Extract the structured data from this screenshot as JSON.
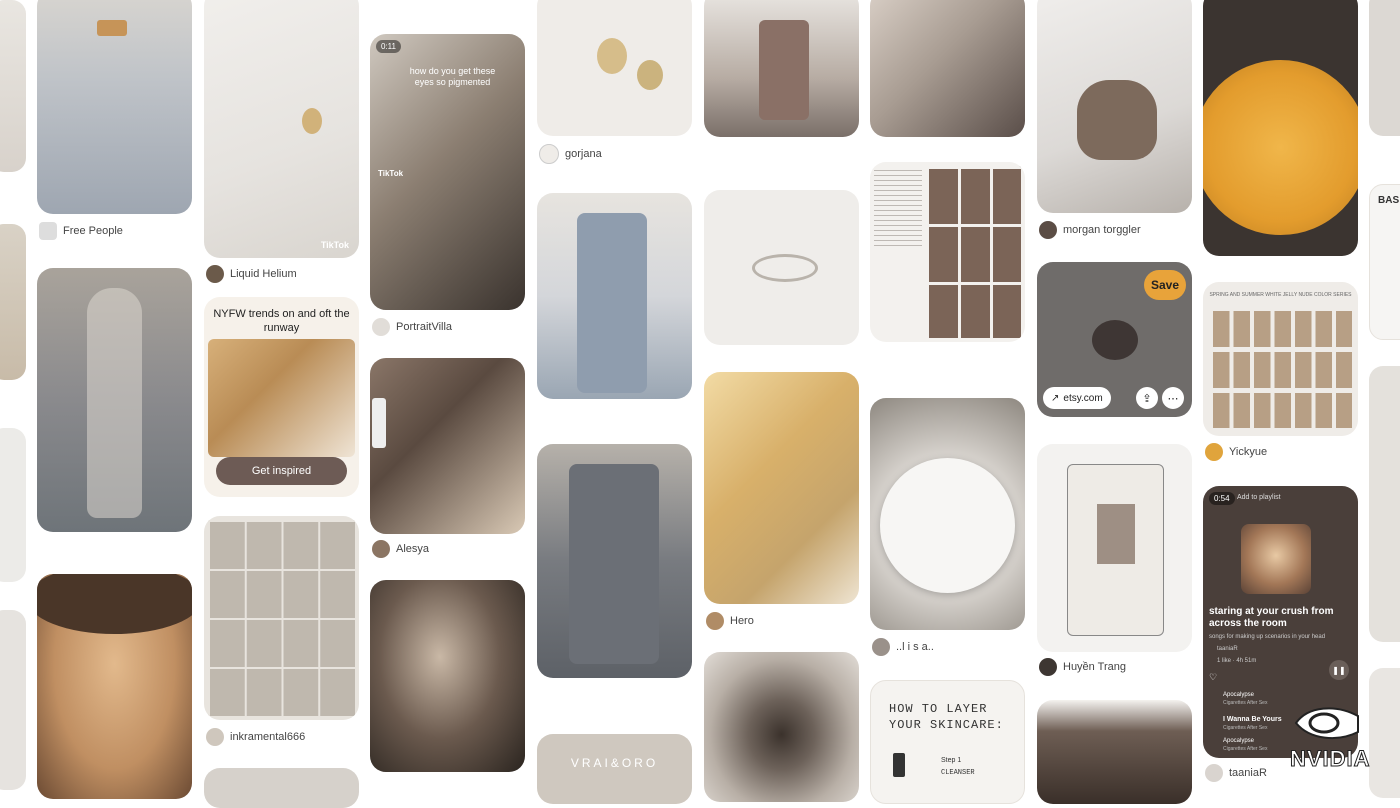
{
  "pins": {
    "free_people": {
      "author": "Free People"
    },
    "liquid_helium": {
      "author": "Liquid Helium",
      "platform": "TikTok"
    },
    "nyfw": {
      "title": "NYFW trends on and oft the runway",
      "cta": "Get inspired"
    },
    "inkramental": {
      "author": "inkramental666"
    },
    "portraitvilla": {
      "author": "PortraitVilla",
      "duration": "0:11",
      "platform": "TikTok",
      "caption": "how do you get these eyes so pigmented"
    },
    "alesya": {
      "author": "Alesya"
    },
    "gorjana": {
      "author": "gorjana"
    },
    "vrai_oro": {
      "overlay_text": "VRAI&ORO"
    },
    "hero": {
      "author": "Hero"
    },
    "lisa": {
      "author": "..l i s a.."
    },
    "skincare": {
      "title": "HOW TO LAYER YOUR SKINCARE:",
      "step": "Step 1",
      "step_label": "CLEANSER"
    },
    "morgan": {
      "author": "morgan torggler"
    },
    "etsy_pin": {
      "save_label": "Save",
      "domain": "etsy.com"
    },
    "huyen": {
      "author": "Huyền Trang"
    },
    "yickyue": {
      "author": "Yickyue",
      "chart_title": "SPRING AND SUMMER WHITE JELLY NUDE COLOR SERIES"
    },
    "playlist": {
      "duration": "0:54",
      "header": "Add to playlist",
      "title": "staring at your crush from across the room",
      "subtitle": "songs for making up scenarios in your head",
      "user": "taaniaR",
      "stats": "1 like · 4h 51m",
      "song1": "Apocalypse",
      "song1_artist": "Cigarettes After Sex",
      "song2": "I Wanna Be Yours",
      "song2_artist": "Cigarettes After Sex",
      "song3": "Apocalypse",
      "song3_artist": "Cigarettes After Sex",
      "author": "taaniaR"
    },
    "basics_edge": {
      "title": "BAS"
    }
  },
  "watermark": {
    "text": "NVIDIA"
  },
  "colors": {
    "accent_orange": "#e7a33e",
    "save_button": "#e8a33a",
    "text": "#222222"
  }
}
